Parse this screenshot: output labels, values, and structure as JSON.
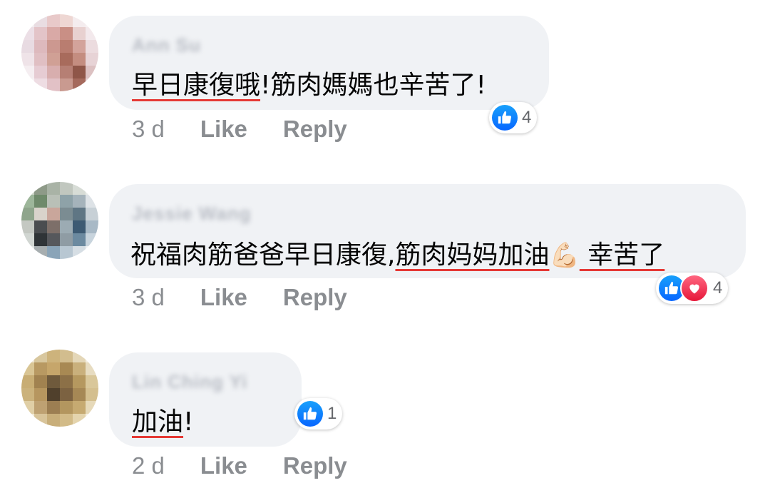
{
  "comments": [
    {
      "author": "Ann Su",
      "text_underlined": "早日康復哦",
      "text_rest": "!筋肉媽媽也辛苦了!",
      "time": "3 d",
      "like_label": "Like",
      "reply_label": "Reply",
      "reaction_count": "4",
      "reactions": [
        "like-icon"
      ]
    },
    {
      "author": "Jessie Wang",
      "text_plain": "祝福肉筋爸爸早日康復,",
      "text_underlined": "筋肉妈妈加油",
      "emoji": "💪🏻",
      "text_underlined_2": " 幸苦了",
      "time": "3 d",
      "like_label": "Like",
      "reply_label": "Reply",
      "reaction_count": "4",
      "reactions": [
        "like-icon",
        "love-icon"
      ]
    },
    {
      "author": "Lin Ching Yi",
      "text_underlined": "加油",
      "text_rest": "!",
      "time": "2 d",
      "like_label": "Like",
      "reply_label": "Reply",
      "reaction_count": "1",
      "reactions": [
        "like-icon"
      ]
    }
  ],
  "colors": {
    "bubble": "#f0f2f5",
    "meta_text": "#8a8d91",
    "underline": "#e53935",
    "like_blue": "#0866ff",
    "love_red": "#e61739"
  }
}
